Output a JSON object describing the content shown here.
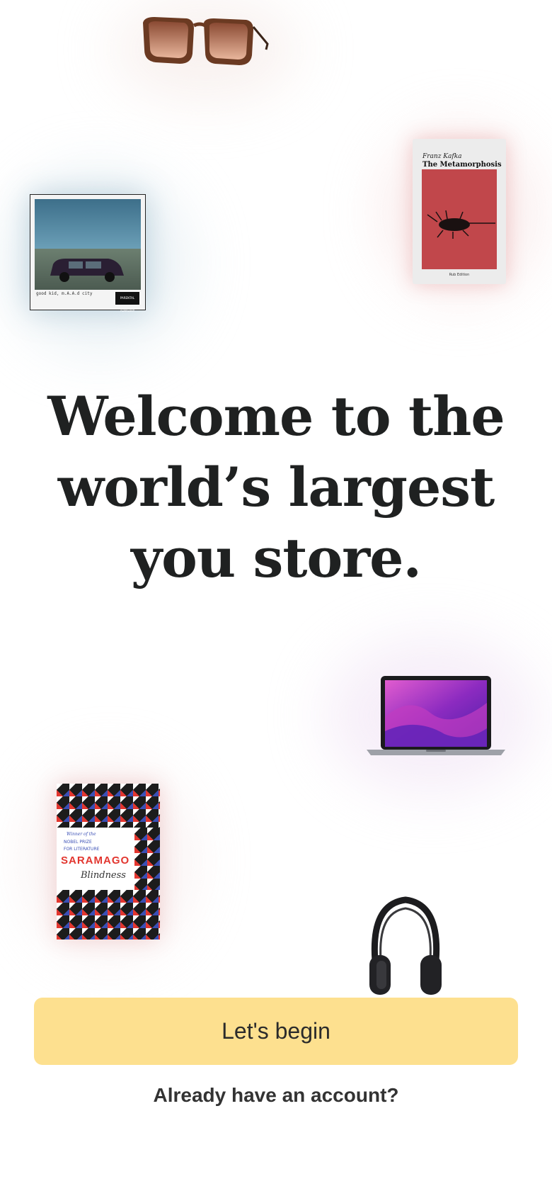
{
  "hero": {
    "line1": "Welcome to the",
    "line2": "world’s largest",
    "line3": "you store."
  },
  "actions": {
    "begin_label": "Let's begin",
    "login_label": "Already have an account?"
  },
  "products": {
    "metamorphosis": {
      "author": "Franz Kafka",
      "title": "The Metamorphosis",
      "edition": "Rub Edition"
    },
    "album": {
      "scrawl": "good kid, m.A.A.d city",
      "advisory": "PARENTAL ADVISORY"
    },
    "blindness": {
      "winner": "Winner of the",
      "prize_line1": "NOBEL PRIZE",
      "prize_line2": "FOR LITERATURE",
      "author": "SARAMAGO",
      "title": "Blindness"
    }
  },
  "colors": {
    "cta_background": "#fde08f",
    "text_dark": "#1f2121"
  }
}
